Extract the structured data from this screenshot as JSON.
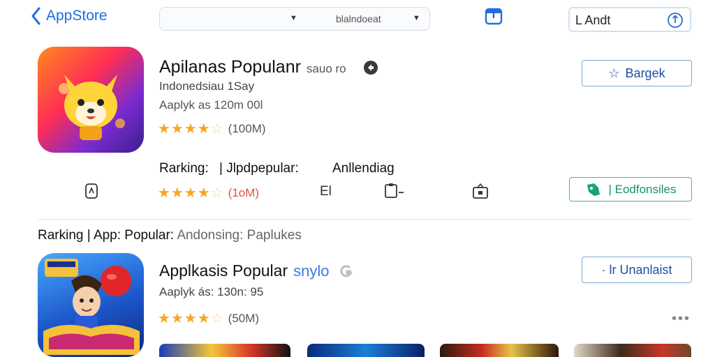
{
  "header": {
    "back_label": "AppStore",
    "dropdown_value": "blalndoeat",
    "search_value": "L Andt"
  },
  "featured": {
    "title": "Apilanas Populanr",
    "title_suffix": "sauo ro",
    "line1": "Indonedsiau 1Say",
    "line2": "Aaplyk as 120m 00l",
    "rating_count": "(100M)",
    "save_label": "Bargek",
    "rank_label": "Rarking:",
    "rank_value": "| Jlpdpepular:",
    "rank_extra": "Anllendiag",
    "rating2_count": "(1oM)",
    "mid_label": "El",
    "green_label": "| Eodfonsiles"
  },
  "section": {
    "label": "Rarking",
    "sep": "|",
    "item1": "App: Popular:",
    "item2": "Andonsing:",
    "item3": "Paplukes"
  },
  "second_app": {
    "title": "Applkasis Popular",
    "title_suffix": "snylo",
    "line1": "Aaplyk ás: 130n: 95",
    "rating_count": "(50M)",
    "update_label": "· lr Unanlaist",
    "more": "•••"
  },
  "colors": {
    "accent": "#1f6fe0",
    "star": "#f5a623",
    "green": "#149372"
  },
  "icons": [
    "chevron-left-icon",
    "caret-down-icon",
    "bookmark-tab-icon",
    "share-icon",
    "game-badge-icon",
    "star-outline-icon",
    "phone-icon",
    "device-icon",
    "gift-icon",
    "game-controller-icon"
  ]
}
